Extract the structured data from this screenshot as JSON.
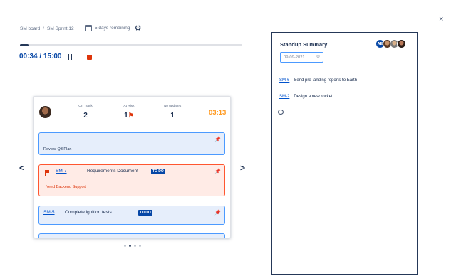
{
  "breadcrumb": {
    "board": "SM board",
    "separator": "/",
    "sprint": "SM Sprint 12"
  },
  "remaining": "5 days remaining",
  "progress": {
    "fraction": 0.04
  },
  "timer": {
    "display": "00:34 / 15:00"
  },
  "icons": {
    "gear": "gear-icon",
    "pause": "pause-icon",
    "stop": "stop-icon",
    "calendar": "calendar-icon",
    "close": "close-icon",
    "pin": "pin-icon",
    "flag": "flag-icon",
    "comment": "comment-icon"
  },
  "carousel": {
    "prev": "<",
    "next": ">",
    "stats": [
      {
        "label": "On Track",
        "value": "2"
      },
      {
        "label": "At Risk",
        "value": "1"
      },
      {
        "label": "No updates",
        "value": "1"
      }
    ],
    "at_risk_flag": "⚑",
    "card_timer": "03:13",
    "tasks": [
      {
        "title": "Review Q3 Plan"
      },
      {
        "key": "SM-7",
        "summary": "Requirements Document",
        "status": "TO DO",
        "note": "Need Backend Support",
        "flagged": true
      },
      {
        "key": "SM-5",
        "summary": "Complete ignition tests",
        "status": "TO DO"
      }
    ],
    "dots": 4,
    "active_dot": 1
  },
  "standup": {
    "title": "Standup Summary",
    "avatar_initials": "AE",
    "date_value": "09-09-2021",
    "items": [
      {
        "key": "SM-6",
        "text": "Send pre-landing reports to Earth"
      },
      {
        "key": "SM-2",
        "text": "Design a new rocket"
      }
    ]
  },
  "close": "×",
  "colors": {
    "accent": "#0747a6",
    "danger": "#de350b",
    "timer": "#ff991f",
    "task_bg": "#e6eefb",
    "flagged_bg": "#ffebe6"
  }
}
